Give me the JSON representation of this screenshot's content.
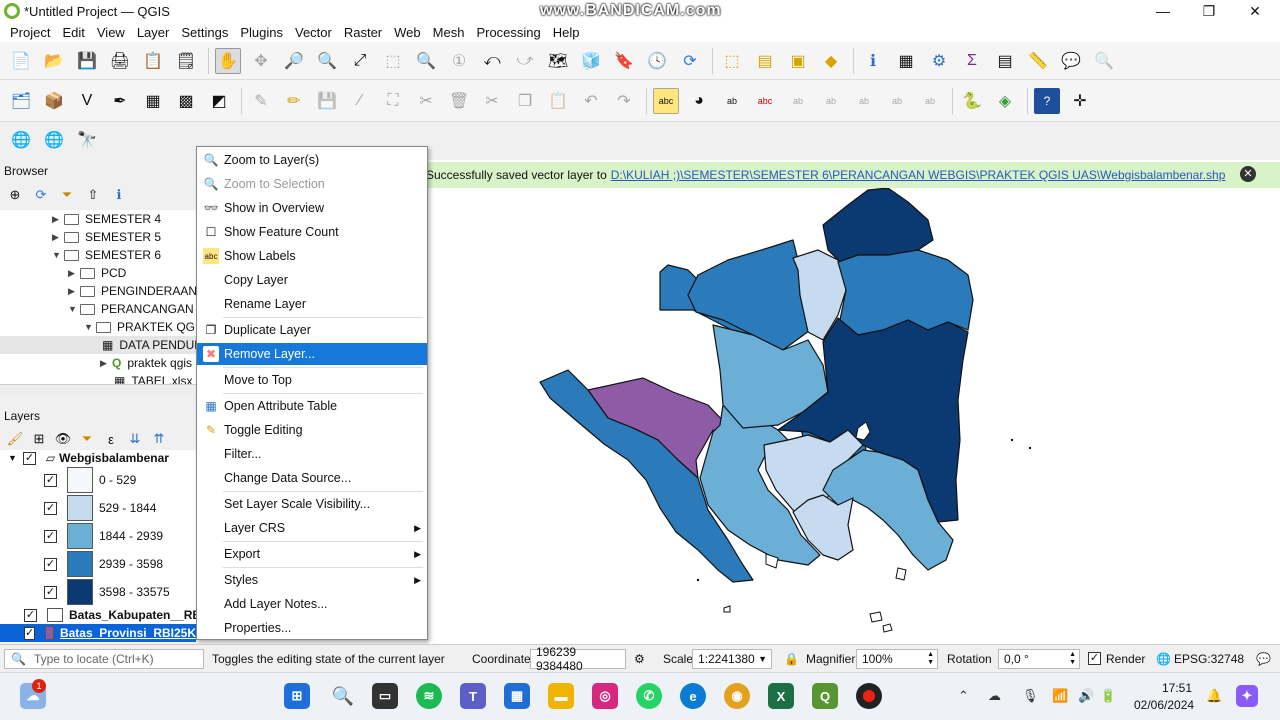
{
  "window": {
    "title": "*Untitled Project — QGIS",
    "watermark": "www.BANDICAM.com"
  },
  "menu": [
    "Project",
    "Edit",
    "View",
    "Layer",
    "Settings",
    "Plugins",
    "Vector",
    "Raster",
    "Web",
    "Mesh",
    "Processing",
    "Help"
  ],
  "browser": {
    "title": "Browser",
    "items": [
      {
        "label": "SEMESTER 4",
        "depth": 0,
        "arrow": "▶"
      },
      {
        "label": "SEMESTER 5",
        "depth": 0,
        "arrow": "▶"
      },
      {
        "label": "SEMESTER 6",
        "depth": 0,
        "arrow": "▼"
      },
      {
        "label": "PCD",
        "depth": 1,
        "arrow": "▶"
      },
      {
        "label": "PENGINDERAAN",
        "depth": 1,
        "arrow": "▶"
      },
      {
        "label": "PERANCANGAN",
        "depth": 1,
        "arrow": "▼"
      },
      {
        "label": "PRAKTEK QGIS",
        "depth": 2,
        "arrow": "▼"
      },
      {
        "label": "DATA PENDUDUK",
        "depth": 3,
        "arrow": ""
      },
      {
        "label": "praktek qgis",
        "depth": 3,
        "arrow": "▶"
      },
      {
        "label": "TABEL.xlsx",
        "depth": 3,
        "arrow": ""
      }
    ]
  },
  "layers": {
    "title": "Layers",
    "group": "Webgisbalambenar",
    "classes": [
      {
        "label": "0 - 529",
        "color": "#f4f8fd"
      },
      {
        "label": "529 - 1844",
        "color": "#c6dbef"
      },
      {
        "label": "1844 - 2939",
        "color": "#6baed6"
      },
      {
        "label": "2939 - 3598",
        "color": "#2b7bba"
      },
      {
        "label": "3598 - 33575",
        "color": "#0b3a73"
      }
    ],
    "layer2": "Batas_Kabupaten__RBI_",
    "layer3": "Batas_Provinsi_RBI25K"
  },
  "message": {
    "text": "Successfully saved vector layer to",
    "path": "D:\\KULIAH ;)\\SEMESTER\\SEMESTER 6\\PERANCANGAN WEBGIS\\PRAKTEK QGIS UAS\\Webgisbalambenar.shp"
  },
  "context_menu": {
    "items": [
      {
        "label": "Zoom to Layer(s)",
        "icon": "🔍",
        "state": "normal",
        "sub": ""
      },
      {
        "label": "Zoom to Selection",
        "icon": "🔍",
        "state": "disabled",
        "sub": ""
      },
      {
        "label": "Show in Overview",
        "icon": "👓",
        "state": "normal",
        "sub": ""
      },
      {
        "label": "Show Feature Count",
        "icon": "☐",
        "state": "normal",
        "sub": ""
      },
      {
        "label": "Show Labels",
        "icon": "abc",
        "state": "normal",
        "sub": ""
      },
      {
        "label": "Copy Layer",
        "icon": "",
        "state": "normal",
        "sub": ""
      },
      {
        "label": "Rename Layer",
        "icon": "",
        "state": "normal",
        "sub": ""
      },
      {
        "label": "Duplicate Layer",
        "icon": "❐",
        "state": "normal",
        "sub": ""
      },
      {
        "label": "Remove Layer...",
        "icon": "✖",
        "state": "highlight",
        "sub": ""
      },
      {
        "label": "Move to Top",
        "icon": "",
        "state": "normal",
        "sub": ""
      },
      {
        "label": "Open Attribute Table",
        "icon": "▦",
        "state": "normal",
        "sub": ""
      },
      {
        "label": "Toggle Editing",
        "icon": "✎",
        "state": "normal",
        "sub": ""
      },
      {
        "label": "Filter...",
        "icon": "",
        "state": "normal",
        "sub": ""
      },
      {
        "label": "Change Data Source...",
        "icon": "",
        "state": "normal",
        "sub": ""
      },
      {
        "label": "Set Layer Scale Visibility...",
        "icon": "",
        "state": "normal",
        "sub": ""
      },
      {
        "label": "Layer CRS",
        "icon": "",
        "state": "normal",
        "sub": "▶"
      },
      {
        "label": "Export",
        "icon": "",
        "state": "normal",
        "sub": "▶"
      },
      {
        "label": "Styles",
        "icon": "",
        "state": "normal",
        "sub": "▶"
      },
      {
        "label": "Add Layer Notes...",
        "icon": "",
        "state": "normal",
        "sub": ""
      },
      {
        "label": "Properties...",
        "icon": "",
        "state": "normal",
        "sub": ""
      }
    ]
  },
  "status": {
    "locate_placeholder": "Type to locate (Ctrl+K)",
    "hint": "Toggles the editing state of the current layer",
    "coordinate_label": "Coordinate",
    "coordinate_value": "196239  9384480",
    "scale_label": "Scale",
    "scale_value": "1:2241380",
    "magnifier_label": "Magnifier",
    "magnifier_value": "100%",
    "rotation_label": "Rotation",
    "rotation_value": "0,0 °",
    "render_label": "Render",
    "crs": "EPSG:32748"
  },
  "taskbar": {
    "time": "17:51",
    "date": "02/06/2024",
    "weather_badge": "1"
  }
}
